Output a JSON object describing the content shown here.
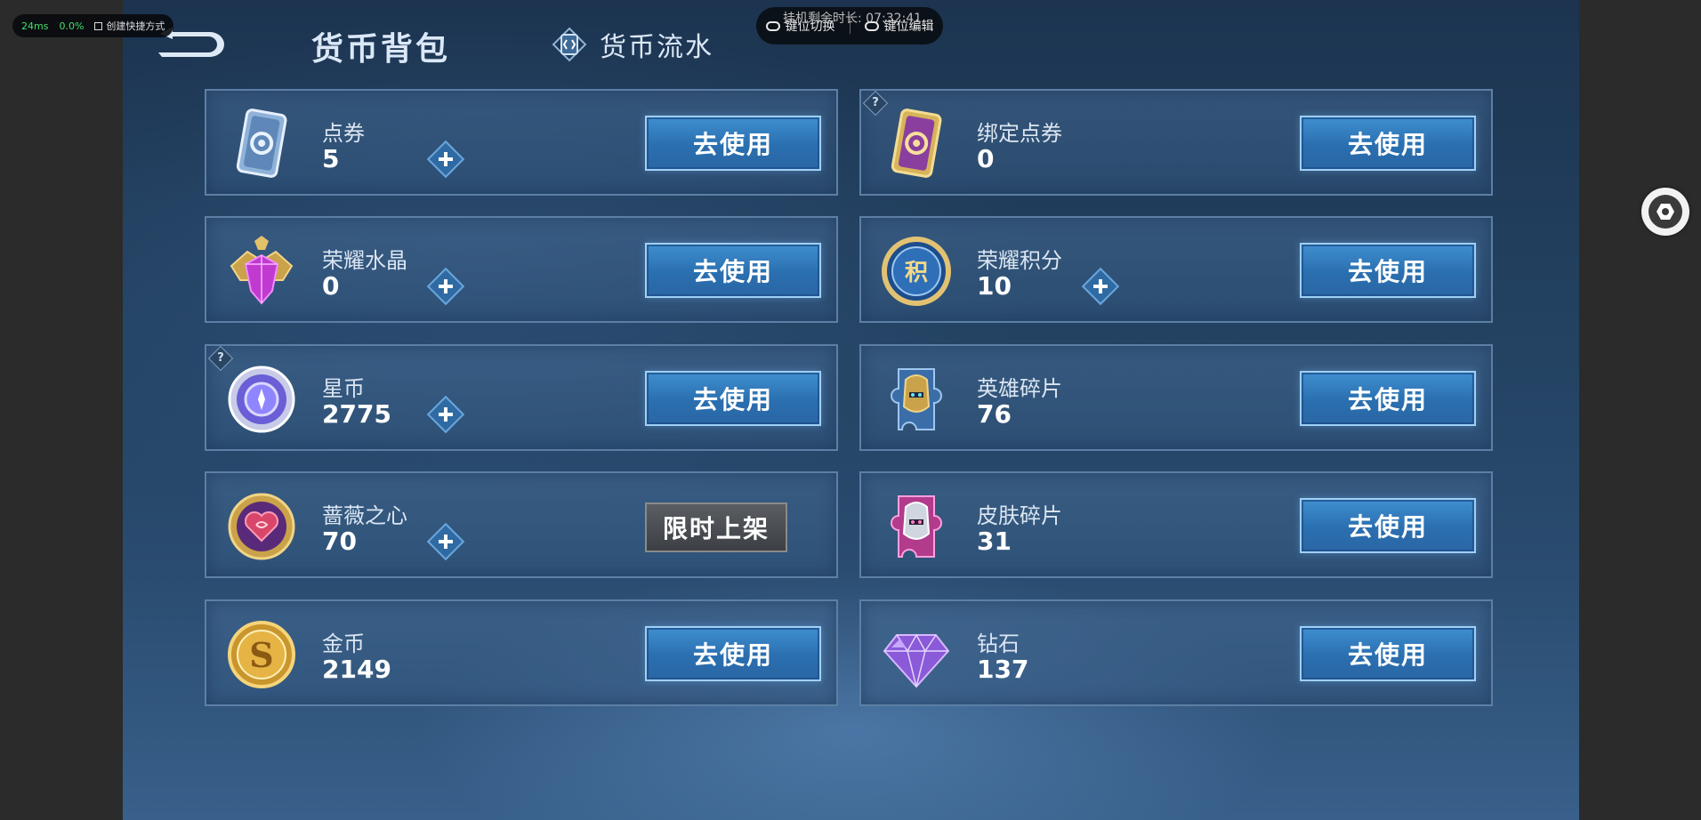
{
  "stats": {
    "ping": "24ms",
    "loss": "0.0%",
    "shortcut_label": "创建快捷方式"
  },
  "overlay": {
    "timer": "挂机剩余时长: 07:32:41",
    "switch_keys": "键位切换",
    "edit_keys": "键位编辑"
  },
  "header": {
    "title": "货币背包",
    "flow_tab": "货币流水"
  },
  "use_label": "去使用",
  "limited_label": "限时上架",
  "currencies": [
    {
      "name": "点券",
      "value": "5",
      "icon": "coupon-card-icon"
    },
    {
      "name": "绑定点券",
      "value": "0",
      "icon": "bound-coupon-card-icon"
    },
    {
      "name": "荣耀水晶",
      "value": "0",
      "icon": "glory-crystal-icon"
    },
    {
      "name": "荣耀积分",
      "value": "10",
      "icon": "glory-points-icon"
    },
    {
      "name": "星币",
      "value": "2775",
      "icon": "star-coin-icon"
    },
    {
      "name": "英雄碎片",
      "value": "76",
      "icon": "hero-fragment-icon"
    },
    {
      "name": "蔷薇之心",
      "value": "70",
      "icon": "rose-heart-icon"
    },
    {
      "name": "皮肤碎片",
      "value": "31",
      "icon": "skin-fragment-icon"
    },
    {
      "name": "金币",
      "value": "2149",
      "icon": "gold-coin-icon"
    },
    {
      "name": "钻石",
      "value": "137",
      "icon": "diamond-icon"
    }
  ],
  "colors": {
    "button_blue": "#2a6fb0",
    "card_border": "#5c7fa5",
    "panel_bg": "#22405f"
  }
}
